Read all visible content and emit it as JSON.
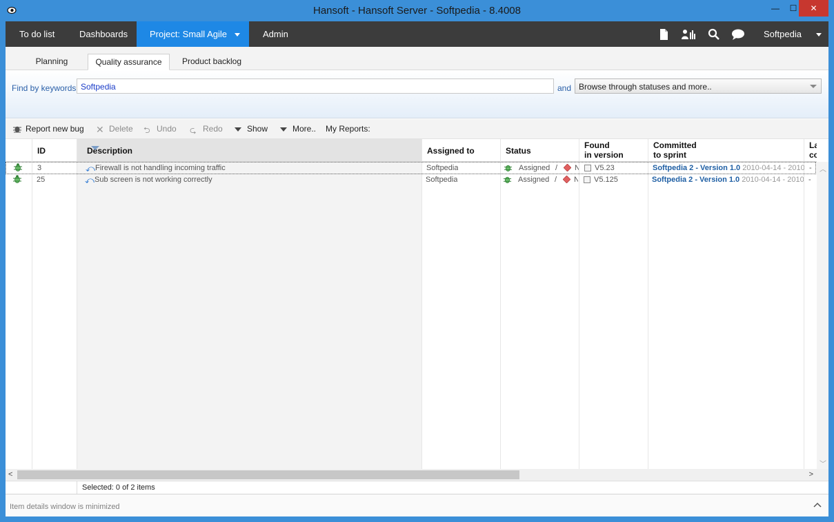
{
  "window": {
    "title": "Hansoft - Hansoft Server - Softpedia - 8.4008",
    "minimize": "—",
    "maximize": "☐",
    "close": "✕"
  },
  "nav": {
    "todo": "To do list",
    "dashboards": "Dashboards",
    "project": "Project: Small Agile",
    "admin": "Admin",
    "user": "Softpedia"
  },
  "subtabs": {
    "planning": "Planning",
    "qa": "Quality assurance",
    "backlog": "Product backlog"
  },
  "filter": {
    "find_label": "Find by keywords",
    "keyword_value": "Softpedia",
    "and_label": "and",
    "status_select": "Browse through statuses and more.."
  },
  "toolbar": {
    "report": "Report new bug",
    "delete": "Delete",
    "undo": "Undo",
    "redo": "Redo",
    "show": "Show",
    "more": "More..",
    "my_reports": "My Reports:"
  },
  "columns": {
    "id": "ID",
    "description": "Description",
    "assigned": "Assigned to",
    "status": "Status",
    "found_1": "Found",
    "found_2": "in version",
    "committed_1": "Committed",
    "committed_2": "to sprint",
    "last_1": "La",
    "last_2": "co"
  },
  "rows": [
    {
      "id": "3",
      "description": "Firewall is not handling incoming traffic",
      "assigned": "Softpedia",
      "status": "Assigned",
      "status_sep": "/",
      "status_extra": "N",
      "found": "V5.23",
      "sprint": "Softpedia 2 - Version 1.0",
      "sprint_dates": "2010-04-14 - 2010",
      "last": "-"
    },
    {
      "id": "25",
      "description": "Sub screen is not working correctly",
      "assigned": "Softpedia",
      "status": "Assigned",
      "status_sep": "/",
      "status_extra": "N",
      "found": "V5.125",
      "sprint": "Softpedia 2 - Version 1.0",
      "sprint_dates": "2010-04-14 - 2010",
      "last": "-"
    }
  ],
  "status_bar": {
    "selected": "Selected: 0 of 2 items"
  },
  "details": {
    "text": "Item details window is minimized"
  },
  "colors": {
    "titlebar": "#3b8fd8",
    "navbar": "#3c3c3c",
    "nav_active": "#1e88e5",
    "sprint_link": "#1f5fa4",
    "bug_icon": "#3a9a3a"
  }
}
